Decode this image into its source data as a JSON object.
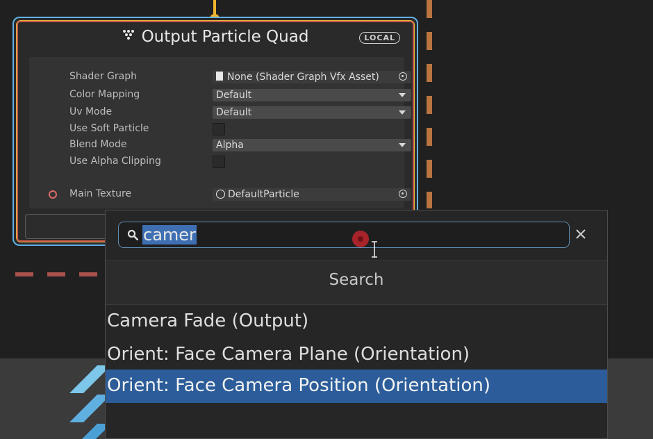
{
  "node": {
    "title": "Output Particle Quad",
    "title_icon": "vfx-output-icon",
    "badge": "LOCAL",
    "properties": [
      {
        "label": "Shader Graph",
        "value": "None (Shader Graph Vfx Asset)",
        "kind": "object-field"
      },
      {
        "label": "Color Mapping",
        "value": "Default",
        "kind": "dropdown"
      },
      {
        "label": "Uv Mode",
        "value": "Default",
        "kind": "dropdown"
      },
      {
        "label": "Use Soft Particle",
        "value": "",
        "kind": "checkbox"
      },
      {
        "label": "Blend Mode",
        "value": "Alpha",
        "kind": "dropdown"
      },
      {
        "label": "Use Alpha Clipping",
        "value": "",
        "kind": "checkbox"
      },
      {
        "label": "Main Texture",
        "value": "DefaultParticle",
        "kind": "texture-field"
      }
    ]
  },
  "search": {
    "query": "camer",
    "header": "Search",
    "results": [
      {
        "label": "Camera Fade (Output)",
        "selected": false
      },
      {
        "label": "Orient: Face Camera Plane (Orientation)",
        "selected": false
      },
      {
        "label": "Orient: Face Camera Position (Orientation)",
        "selected": true
      }
    ]
  },
  "colors": {
    "selection": "#2c5d9a",
    "node_border_blue": "#5fb0e6",
    "node_border_orange": "#e6b83a",
    "flow_port": "#f0b52c"
  }
}
